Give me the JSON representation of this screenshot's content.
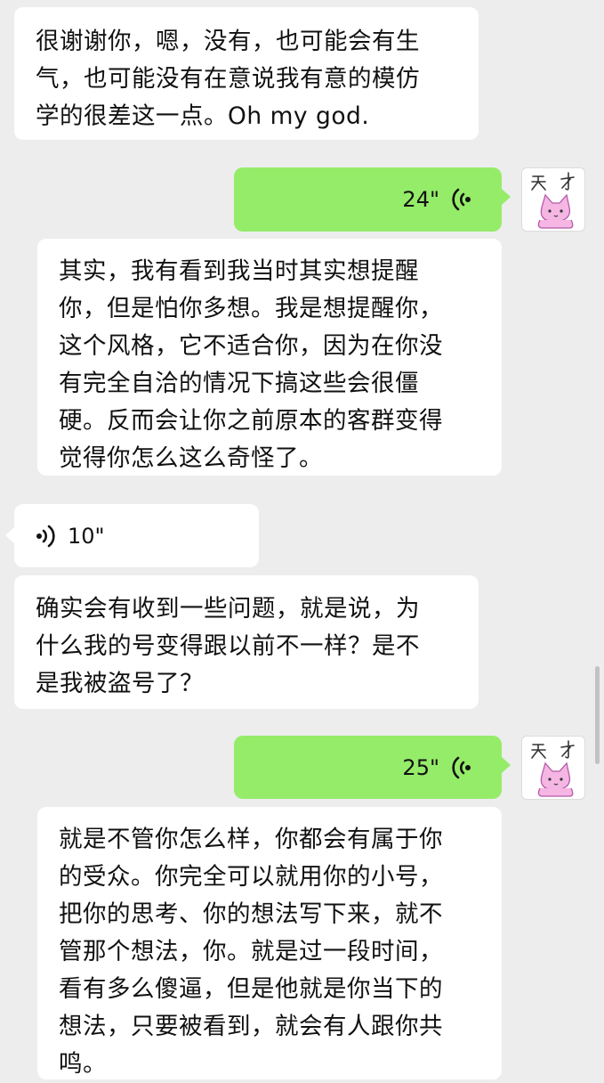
{
  "messages": [
    {
      "side": "left",
      "type": "text",
      "text": "很谢谢你，嗯，没有，也可能会有生\n气，也可能没有在意说我有意的模仿\n学的很差这一点。Oh my god."
    },
    {
      "side": "right",
      "type": "voice",
      "duration": "24\""
    },
    {
      "side": "left",
      "type": "text",
      "text": "其实，我有看到我当时其实想提醒\n你，但是怕你多想。我是想提醒你，\n这个风格，它不适合你，因为在你没\n有完全自洽的情况下搞这些会很僵\n硬。反而会让你之前原本的客群变得\n觉得你怎么这么奇怪了。"
    },
    {
      "side": "left",
      "type": "voice",
      "duration": "10\""
    },
    {
      "side": "left",
      "type": "text",
      "text": "确实会有收到一些问题，就是说，为\n什么我的号变得跟以前不一样？是不\n是我被盗号了？"
    },
    {
      "side": "right",
      "type": "voice",
      "duration": "25\""
    },
    {
      "side": "left",
      "type": "text",
      "text": "就是不管你怎么样，你都会有属于你\n的受众。你完全可以就用你的小号，\n把你的思考、你的想法写下来，就不\n管那个想法，你。就是过一段时间，\n看有多么傻逼，但是他就是你当下的\n想法，只要被看到，就会有人跟你共\n鸣。"
    }
  ],
  "avatar": {
    "text": "天才",
    "icon": "pink-cat-avatar"
  },
  "colors": {
    "background": "#ededed",
    "incoming": "#ffffff",
    "outgoing": "#95ec69"
  }
}
